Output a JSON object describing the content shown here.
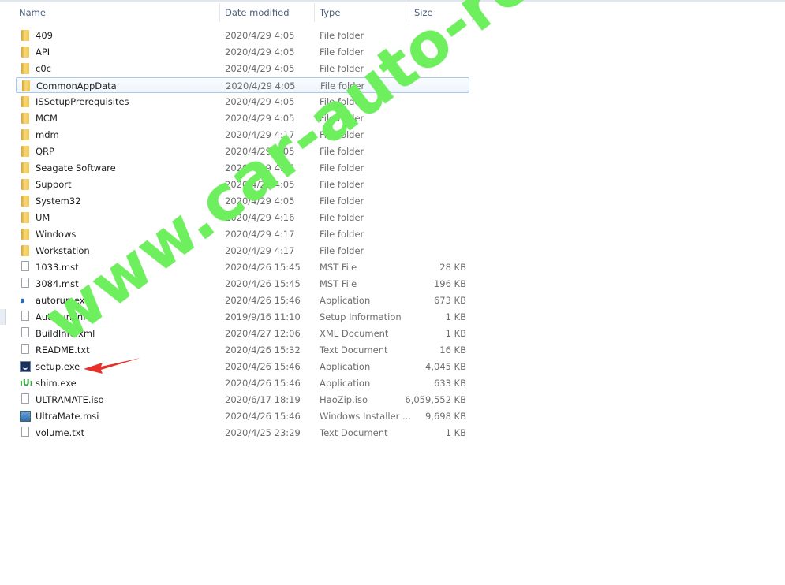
{
  "columns": {
    "name": "Name",
    "date": "Date modified",
    "type": "Type",
    "size": "Size"
  },
  "files": [
    {
      "name": "409",
      "date": "2020/4/29 4:05",
      "type": "File folder",
      "size": "",
      "icon": "folder"
    },
    {
      "name": "API",
      "date": "2020/4/29 4:05",
      "type": "File folder",
      "size": "",
      "icon": "folder"
    },
    {
      "name": "c0c",
      "date": "2020/4/29 4:05",
      "type": "File folder",
      "size": "",
      "icon": "folder"
    },
    {
      "name": "CommonAppData",
      "date": "2020/4/29 4:05",
      "type": "File folder",
      "size": "",
      "icon": "folder",
      "selected": true
    },
    {
      "name": "ISSetupPrerequisites",
      "date": "2020/4/29 4:05",
      "type": "File folder",
      "size": "",
      "icon": "folder"
    },
    {
      "name": "MCM",
      "date": "2020/4/29 4:05",
      "type": "File folder",
      "size": "",
      "icon": "folder"
    },
    {
      "name": "mdm",
      "date": "2020/4/29 4:17",
      "type": "File folder",
      "size": "",
      "icon": "folder"
    },
    {
      "name": "QRP",
      "date": "2020/4/29 4:05",
      "type": "File folder",
      "size": "",
      "icon": "folder"
    },
    {
      "name": "Seagate Software",
      "date": "2020/4/29 4:05",
      "type": "File folder",
      "size": "",
      "icon": "folder"
    },
    {
      "name": "Support",
      "date": "2020/4/29 4:05",
      "type": "File folder",
      "size": "",
      "icon": "folder"
    },
    {
      "name": "System32",
      "date": "2020/4/29 4:05",
      "type": "File folder",
      "size": "",
      "icon": "folder"
    },
    {
      "name": "UM",
      "date": "2020/4/29 4:16",
      "type": "File folder",
      "size": "",
      "icon": "folder"
    },
    {
      "name": "Windows",
      "date": "2020/4/29 4:17",
      "type": "File folder",
      "size": "",
      "icon": "folder"
    },
    {
      "name": "Workstation",
      "date": "2020/4/29 4:17",
      "type": "File folder",
      "size": "",
      "icon": "folder"
    },
    {
      "name": "1033.mst",
      "date": "2020/4/26 15:45",
      "type": "MST File",
      "size": "28 KB",
      "icon": "file"
    },
    {
      "name": "3084.mst",
      "date": "2020/4/26 15:45",
      "type": "MST File",
      "size": "196 KB",
      "icon": "file"
    },
    {
      "name": "autorun.exe",
      "date": "2020/4/26 15:46",
      "type": "Application",
      "size": "673 KB",
      "icon": "exe"
    },
    {
      "name": "Autorun.inf",
      "date": "2019/9/16 11:10",
      "type": "Setup Information",
      "size": "1 KB",
      "icon": "file"
    },
    {
      "name": "BuildInfo.xml",
      "date": "2020/4/27 12:06",
      "type": "XML Document",
      "size": "1 KB",
      "icon": "file"
    },
    {
      "name": "README.txt",
      "date": "2020/4/26 15:32",
      "type": "Text Document",
      "size": "16 KB",
      "icon": "file"
    },
    {
      "name": "setup.exe",
      "date": "2020/4/26 15:46",
      "type": "Application",
      "size": "4,045 KB",
      "icon": "setup"
    },
    {
      "name": "shim.exe",
      "date": "2020/4/26 15:46",
      "type": "Application",
      "size": "633 KB",
      "icon": "shim"
    },
    {
      "name": "ULTRAMATE.iso",
      "date": "2020/6/17 18:19",
      "type": "HaoZip.iso",
      "size": "6,059,552 KB",
      "icon": "file"
    },
    {
      "name": "UltraMate.msi",
      "date": "2020/4/26 15:46",
      "type": "Windows Installer ...",
      "size": "9,698 KB",
      "icon": "msi"
    },
    {
      "name": "volume.txt",
      "date": "2020/4/25 23:29",
      "type": "Text Document",
      "size": "1 KB",
      "icon": "file"
    }
  ],
  "watermark": "www.car-auto-repair.com",
  "colors": {
    "watermark": "#6ef05e",
    "arrow": "#e8302a",
    "selection": "#a8c8e8"
  }
}
